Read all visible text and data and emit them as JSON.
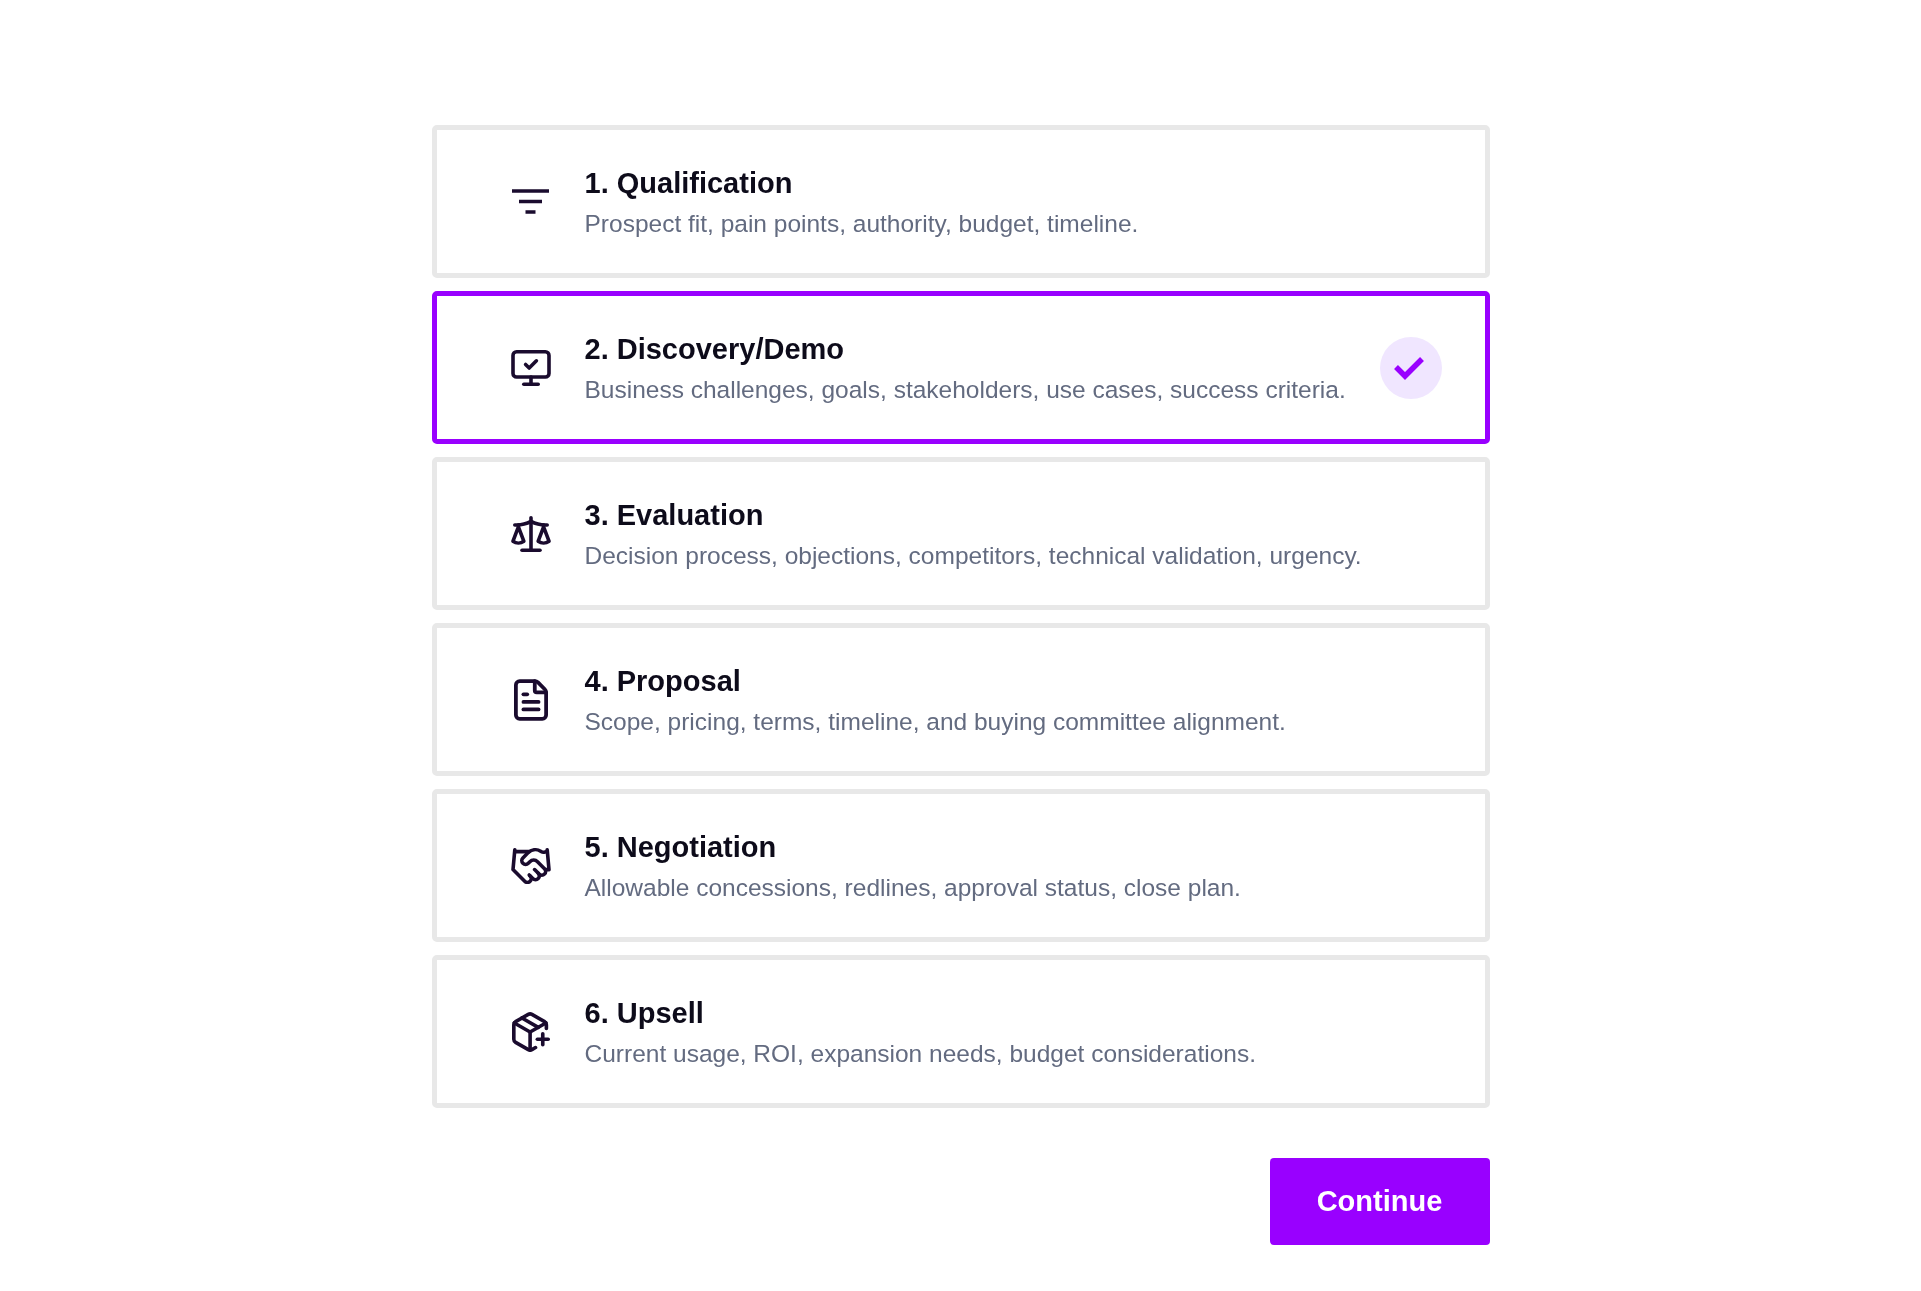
{
  "stages": [
    {
      "title": "1. Qualification",
      "description": "Prospect fit, pain points, authority, budget, timeline.",
      "selected": false
    },
    {
      "title": "2. Discovery/Demo",
      "description": "Business challenges, goals, stakeholders, use cases, success criteria.",
      "selected": true
    },
    {
      "title": "3. Evaluation",
      "description": "Decision process, objections, competitors, technical validation, urgency.",
      "selected": false
    },
    {
      "title": "4. Proposal",
      "description": "Scope, pricing, terms, timeline, and buying committee alignment.",
      "selected": false
    },
    {
      "title": "5. Negotiation",
      "description": "Allowable concessions, redlines, approval status, close plan.",
      "selected": false
    },
    {
      "title": "6. Upsell",
      "description": "Current usage, ROI, expansion needs, budget considerations.",
      "selected": false
    }
  ],
  "continue_button": {
    "label": "Continue"
  }
}
